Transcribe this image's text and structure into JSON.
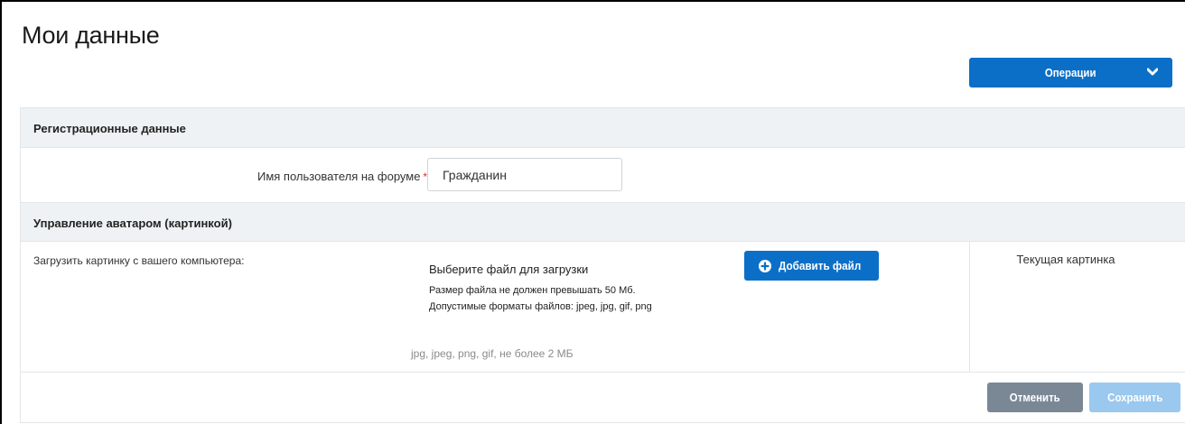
{
  "page": {
    "title": "Мои данные"
  },
  "operations": {
    "label": "Операции",
    "icon": "chevron-down-icon"
  },
  "sections": {
    "registration": {
      "header": "Регистрационные данные",
      "username_label": "Имя пользователя на форуме",
      "required_mark": "*",
      "username_value": "Гражданин"
    },
    "avatar": {
      "header": "Управление аватаром (картинкой)",
      "upload_label": "Загрузить картинку с вашего компьютера:",
      "choose_file": "Выберите файл для загрузки",
      "size_note": "Размер файла не должен превышать 50 Мб.",
      "formats_note": "Допустимые форматы файлов: jpeg, jpg, gif, png",
      "hint": "jpg, jpeg, png, gif, не более 2 МБ",
      "add_file_label": "Добавить файл",
      "add_file_icon": "plus-circle-icon",
      "current_picture_label": "Текущая картинка"
    }
  },
  "actions": {
    "cancel_label": "Отменить",
    "save_label": "Сохранить"
  },
  "colors": {
    "primary": "#0b6fc7",
    "section_bg": "#eef2f4",
    "cancel": "#7a8896",
    "save_disabled": "#9ac8ee"
  }
}
